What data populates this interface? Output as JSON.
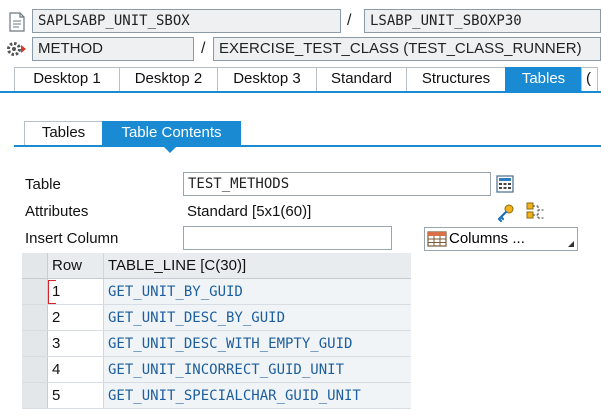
{
  "header": {
    "program": "SAPLSABP_UNIT_SBOX",
    "include": "LSABP_UNIT_SBOXP30",
    "kind": "METHOD",
    "context": "EXERCISE_TEST_CLASS (TEST_CLASS_RUNNER)",
    "separator": "/"
  },
  "desktop_tabs": [
    {
      "label": "Desktop 1",
      "active": false
    },
    {
      "label": "Desktop 2",
      "active": false
    },
    {
      "label": "Desktop 3",
      "active": false
    },
    {
      "label": "Standard",
      "active": false
    },
    {
      "label": "Structures",
      "active": false
    },
    {
      "label": "Tables",
      "active": true
    },
    {
      "label": "(",
      "active": false
    }
  ],
  "sub_tabs": [
    {
      "label": "Tables",
      "active": false
    },
    {
      "label": "Table Contents",
      "active": true
    }
  ],
  "form": {
    "table_label": "Table",
    "table_value": "TEST_METHODS",
    "attributes_label": "Attributes",
    "attributes_value": "Standard [5x1(60)]",
    "insert_column_label": "Insert Column",
    "insert_column_value": "",
    "columns_button": "Columns ..."
  },
  "grid": {
    "headers": [
      "Row",
      "TABLE_LINE [C(30)]"
    ],
    "rows": [
      [
        "1",
        "GET_UNIT_BY_GUID"
      ],
      [
        "2",
        "GET_UNIT_DESC_BY_GUID"
      ],
      [
        "3",
        "GET_UNIT_DESC_WITH_EMPTY_GUID"
      ],
      [
        "4",
        "GET_UNIT_INCORRECT_GUID_UNIT"
      ],
      [
        "5",
        "GET_UNIT_SPECIALCHAR_GUID_UNIT"
      ]
    ]
  },
  "colors": {
    "accent": "#1a8bd2",
    "value_text": "#1c5e9e"
  },
  "icons": [
    "document-icon",
    "gear-icon",
    "calculator-icon",
    "key-icon",
    "structure-icon",
    "table-icon",
    "dropdown-corner-icon"
  ]
}
